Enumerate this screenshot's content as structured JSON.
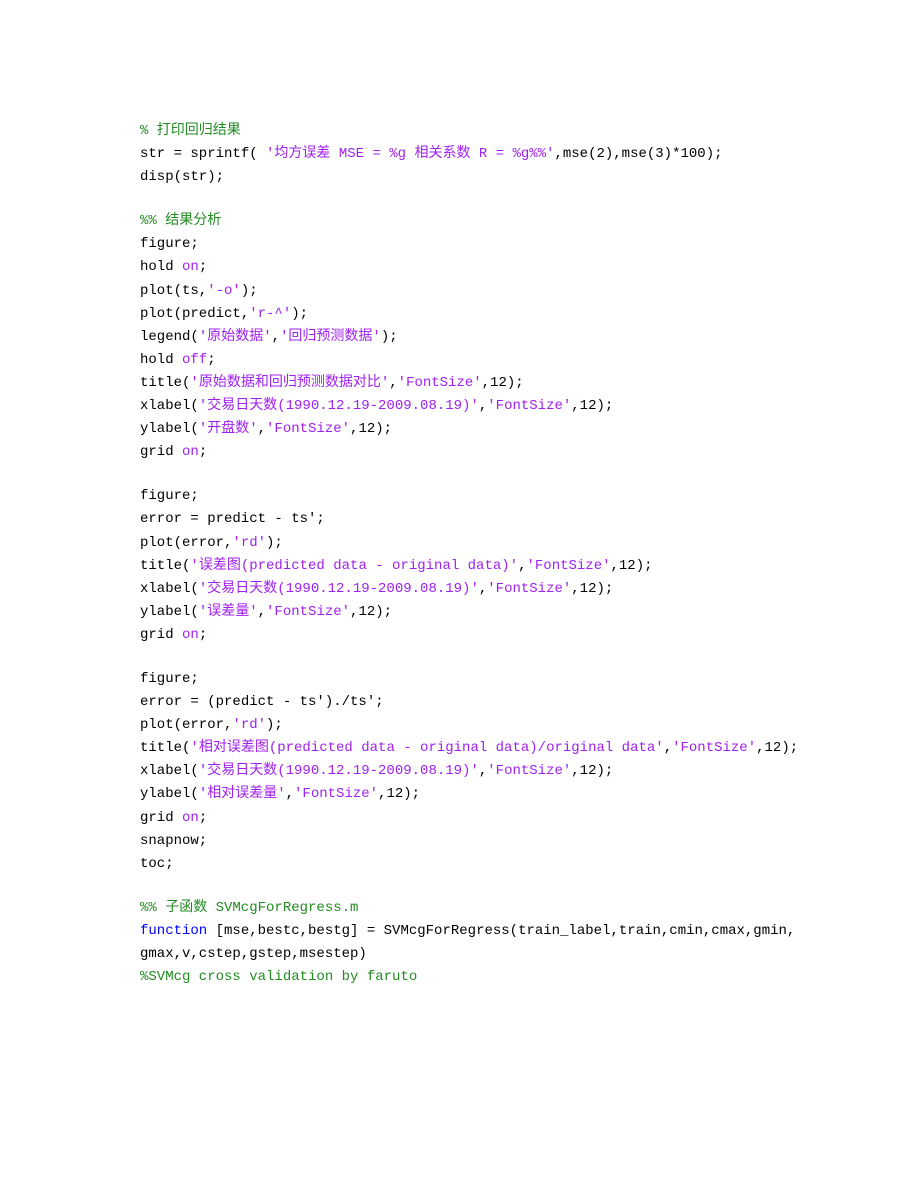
{
  "lines": [
    {
      "spans": [
        {
          "cls": "c",
          "t": "% 打印回归结果"
        }
      ]
    },
    {
      "spans": [
        {
          "cls": "p",
          "t": "str = sprintf( "
        },
        {
          "cls": "s",
          "t": "'均方误差 MSE = %g 相关系数 R = %g%%'"
        },
        {
          "cls": "p",
          "t": ",mse(2),mse(3)*100);"
        }
      ]
    },
    {
      "spans": [
        {
          "cls": "p",
          "t": "disp(str);"
        }
      ]
    },
    {
      "blank": true
    },
    {
      "spans": [
        {
          "cls": "c",
          "t": "%% 结果分析"
        }
      ]
    },
    {
      "spans": [
        {
          "cls": "p",
          "t": "figure;"
        }
      ]
    },
    {
      "spans": [
        {
          "cls": "p",
          "t": "hold "
        },
        {
          "cls": "s",
          "t": "on"
        },
        {
          "cls": "p",
          "t": ";"
        }
      ]
    },
    {
      "spans": [
        {
          "cls": "p",
          "t": "plot(ts,"
        },
        {
          "cls": "s",
          "t": "'-o'"
        },
        {
          "cls": "p",
          "t": ");"
        }
      ]
    },
    {
      "spans": [
        {
          "cls": "p",
          "t": "plot(predict,"
        },
        {
          "cls": "s",
          "t": "'r-^'"
        },
        {
          "cls": "p",
          "t": ");"
        }
      ]
    },
    {
      "spans": [
        {
          "cls": "p",
          "t": "legend("
        },
        {
          "cls": "s",
          "t": "'原始数据'"
        },
        {
          "cls": "p",
          "t": ","
        },
        {
          "cls": "s",
          "t": "'回归预测数据'"
        },
        {
          "cls": "p",
          "t": ");"
        }
      ]
    },
    {
      "spans": [
        {
          "cls": "p",
          "t": "hold "
        },
        {
          "cls": "s",
          "t": "off"
        },
        {
          "cls": "p",
          "t": ";"
        }
      ]
    },
    {
      "spans": [
        {
          "cls": "p",
          "t": "title("
        },
        {
          "cls": "s",
          "t": "'原始数据和回归预测数据对比'"
        },
        {
          "cls": "p",
          "t": ","
        },
        {
          "cls": "s",
          "t": "'FontSize'"
        },
        {
          "cls": "p",
          "t": ",12);"
        }
      ]
    },
    {
      "spans": [
        {
          "cls": "p",
          "t": "xlabel("
        },
        {
          "cls": "s",
          "t": "'交易日天数(1990.12.19-2009.08.19)'"
        },
        {
          "cls": "p",
          "t": ","
        },
        {
          "cls": "s",
          "t": "'FontSize'"
        },
        {
          "cls": "p",
          "t": ",12);"
        }
      ]
    },
    {
      "spans": [
        {
          "cls": "p",
          "t": "ylabel("
        },
        {
          "cls": "s",
          "t": "'开盘数'"
        },
        {
          "cls": "p",
          "t": ","
        },
        {
          "cls": "s",
          "t": "'FontSize'"
        },
        {
          "cls": "p",
          "t": ",12);"
        }
      ]
    },
    {
      "spans": [
        {
          "cls": "p",
          "t": "grid "
        },
        {
          "cls": "s",
          "t": "on"
        },
        {
          "cls": "p",
          "t": ";"
        }
      ]
    },
    {
      "blank": true
    },
    {
      "spans": [
        {
          "cls": "p",
          "t": "figure;"
        }
      ]
    },
    {
      "spans": [
        {
          "cls": "p",
          "t": "error = predict - ts';"
        }
      ]
    },
    {
      "spans": [
        {
          "cls": "p",
          "t": "plot(error,"
        },
        {
          "cls": "s",
          "t": "'rd'"
        },
        {
          "cls": "p",
          "t": ");"
        }
      ]
    },
    {
      "spans": [
        {
          "cls": "p",
          "t": "title("
        },
        {
          "cls": "s",
          "t": "'误差图(predicted data - original data)'"
        },
        {
          "cls": "p",
          "t": ","
        },
        {
          "cls": "s",
          "t": "'FontSize'"
        },
        {
          "cls": "p",
          "t": ",12);"
        }
      ]
    },
    {
      "spans": [
        {
          "cls": "p",
          "t": "xlabel("
        },
        {
          "cls": "s",
          "t": "'交易日天数(1990.12.19-2009.08.19)'"
        },
        {
          "cls": "p",
          "t": ","
        },
        {
          "cls": "s",
          "t": "'FontSize'"
        },
        {
          "cls": "p",
          "t": ",12);"
        }
      ]
    },
    {
      "spans": [
        {
          "cls": "p",
          "t": "ylabel("
        },
        {
          "cls": "s",
          "t": "'误差量'"
        },
        {
          "cls": "p",
          "t": ","
        },
        {
          "cls": "s",
          "t": "'FontSize'"
        },
        {
          "cls": "p",
          "t": ",12);"
        }
      ]
    },
    {
      "spans": [
        {
          "cls": "p",
          "t": "grid "
        },
        {
          "cls": "s",
          "t": "on"
        },
        {
          "cls": "p",
          "t": ";"
        }
      ]
    },
    {
      "blank": true
    },
    {
      "spans": [
        {
          "cls": "p",
          "t": "figure;"
        }
      ]
    },
    {
      "spans": [
        {
          "cls": "p",
          "t": "error = (predict - ts')./ts';"
        }
      ]
    },
    {
      "spans": [
        {
          "cls": "p",
          "t": "plot(error,"
        },
        {
          "cls": "s",
          "t": "'rd'"
        },
        {
          "cls": "p",
          "t": ");"
        }
      ]
    },
    {
      "spans": [
        {
          "cls": "p",
          "t": "title("
        },
        {
          "cls": "s",
          "t": "'相对误差图(predicted data - original data)/original data'"
        },
        {
          "cls": "p",
          "t": ","
        },
        {
          "cls": "s",
          "t": "'FontSize'"
        },
        {
          "cls": "p",
          "t": ",12);"
        }
      ]
    },
    {
      "spans": [
        {
          "cls": "p",
          "t": "xlabel("
        },
        {
          "cls": "s",
          "t": "'交易日天数(1990.12.19-2009.08.19)'"
        },
        {
          "cls": "p",
          "t": ","
        },
        {
          "cls": "s",
          "t": "'FontSize'"
        },
        {
          "cls": "p",
          "t": ",12);"
        }
      ]
    },
    {
      "spans": [
        {
          "cls": "p",
          "t": "ylabel("
        },
        {
          "cls": "s",
          "t": "'相对误差量'"
        },
        {
          "cls": "p",
          "t": ","
        },
        {
          "cls": "s",
          "t": "'FontSize'"
        },
        {
          "cls": "p",
          "t": ",12);"
        }
      ]
    },
    {
      "spans": [
        {
          "cls": "p",
          "t": "grid "
        },
        {
          "cls": "s",
          "t": "on"
        },
        {
          "cls": "p",
          "t": ";"
        }
      ]
    },
    {
      "spans": [
        {
          "cls": "p",
          "t": "snapnow;"
        }
      ]
    },
    {
      "spans": [
        {
          "cls": "p",
          "t": "toc;"
        }
      ]
    },
    {
      "blank": true
    },
    {
      "spans": [
        {
          "cls": "c",
          "t": "%% 子函数 SVMcgForRegress.m"
        }
      ]
    },
    {
      "spans": [
        {
          "cls": "k",
          "t": "function"
        },
        {
          "cls": "p",
          "t": " [mse,bestc,bestg] = SVMcgForRegress(train_label,train,cmin,cmax,gmin,gmax,v,cstep,gstep,msestep)"
        }
      ]
    },
    {
      "spans": [
        {
          "cls": "c",
          "t": "%SVMcg cross validation by faruto"
        }
      ]
    }
  ]
}
